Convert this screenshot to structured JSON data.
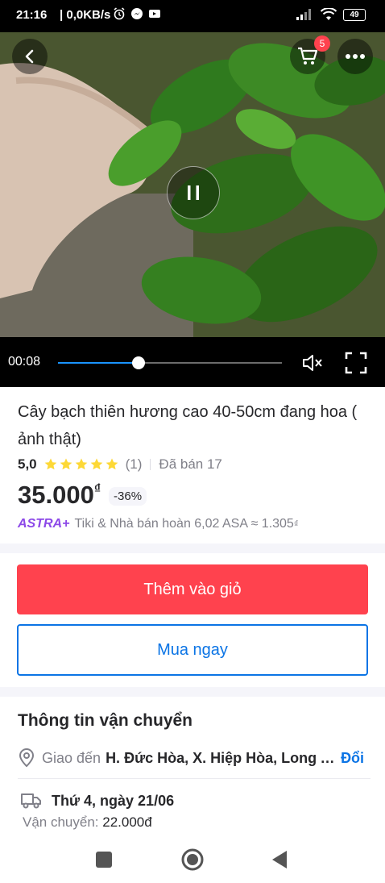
{
  "status_bar": {
    "time": "21:16",
    "speed": "| 0,0KB/s",
    "battery": "49"
  },
  "header": {
    "cart_badge": "5"
  },
  "video": {
    "time": "00:08",
    "progress": 0.36
  },
  "product": {
    "title": "Cây bạch thiên hương cao 40-50cm đang hoa ( ảnh thật)",
    "rating_score": "5,0",
    "stars": 5,
    "review_count": "(1)",
    "sold": "Đã bán 17",
    "price": "35.000",
    "price_currency": "₫",
    "discount": "-36%",
    "astra_brand": "ASTRA+",
    "astra_text": "Tiki & Nhà bán hoàn 6,02 ASA ≈ 1.305",
    "astra_currency": "₫"
  },
  "actions": {
    "add_to_cart": "Thêm vào giỏ",
    "buy_now": "Mua ngay"
  },
  "shipping": {
    "title": "Thông tin vận chuyển",
    "address_label": "Giao đến",
    "address_value": "H. Đức Hòa, X. Hiệp Hòa, Long An",
    "change": "Đổi",
    "delivery_date": "Thứ 4, ngày 21/06",
    "fee_label": "Vận chuyển:",
    "fee_value": "22.000đ"
  },
  "colors": {
    "primary_red": "#ff424e",
    "link_blue": "#0b74e5",
    "astra_purple": "#8d49e8",
    "star_yellow": "#fdd836"
  },
  "icons": [
    "back-arrow-icon",
    "cart-icon",
    "more-icon",
    "pause-icon",
    "mute-icon",
    "fullscreen-icon",
    "location-icon",
    "truck-icon",
    "square-nav-icon",
    "home-nav-icon",
    "back-nav-icon"
  ]
}
